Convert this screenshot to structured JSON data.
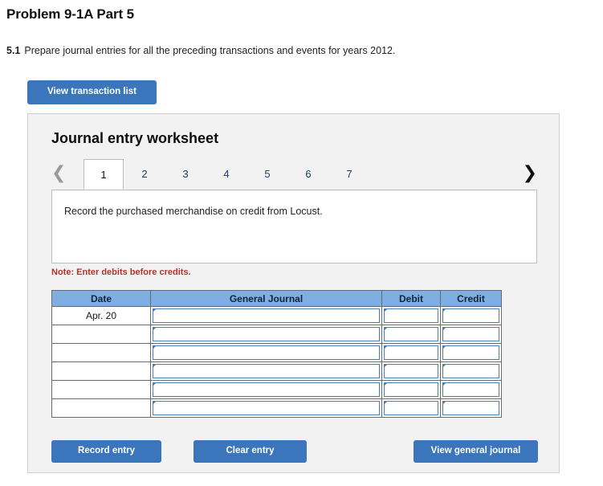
{
  "header": {
    "problem_title": "Problem 9-1A Part 5",
    "requirement_number": "5.1",
    "requirement_text": "Prepare journal entries for all the preceding transactions and events for years 2012."
  },
  "toolbar": {
    "view_transaction_list_label": "View transaction list"
  },
  "worksheet": {
    "title": "Journal entry worksheet",
    "prev_icon": "chevron-left-icon",
    "next_icon": "chevron-right-icon",
    "tabs": [
      {
        "label": "1",
        "active": true
      },
      {
        "label": "2",
        "active": false
      },
      {
        "label": "3",
        "active": false
      },
      {
        "label": "4",
        "active": false
      },
      {
        "label": "5",
        "active": false
      },
      {
        "label": "6",
        "active": false
      },
      {
        "label": "7",
        "active": false
      }
    ],
    "description": "Record the purchased merchandise on credit from Locust.",
    "note": "Note: Enter debits before credits."
  },
  "journal_table": {
    "columns": [
      "Date",
      "General Journal",
      "Debit",
      "Credit"
    ],
    "rows": [
      {
        "date": "Apr. 20",
        "general_journal": "",
        "debit": "",
        "credit": ""
      },
      {
        "date": "",
        "general_journal": "",
        "debit": "",
        "credit": ""
      },
      {
        "date": "",
        "general_journal": "",
        "debit": "",
        "credit": ""
      },
      {
        "date": "",
        "general_journal": "",
        "debit": "",
        "credit": ""
      },
      {
        "date": "",
        "general_journal": "",
        "debit": "",
        "credit": ""
      },
      {
        "date": "",
        "general_journal": "",
        "debit": "",
        "credit": ""
      }
    ]
  },
  "footer": {
    "record_entry_label": "Record entry",
    "clear_entry_label": "Clear entry",
    "view_general_journal_label": "View general journal"
  },
  "colors": {
    "button_blue": "#3b76bd",
    "table_header_blue": "#7eaee2",
    "note_red": "#b0342c",
    "panel_background": "#f2f2f2",
    "field_border_blue": "#4a7cb5"
  }
}
